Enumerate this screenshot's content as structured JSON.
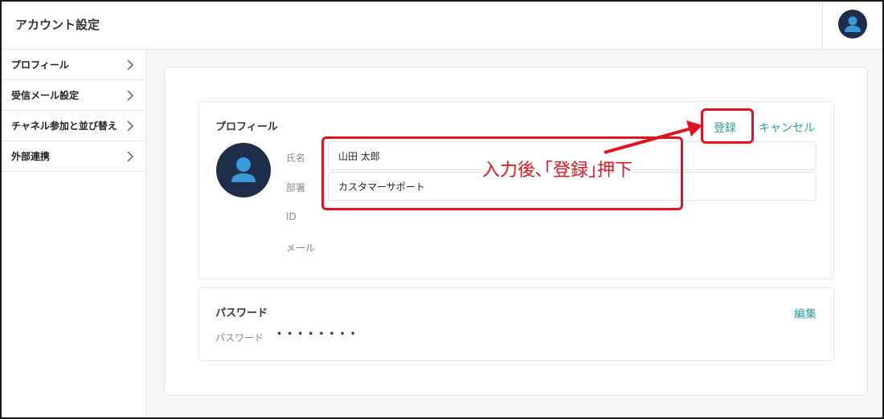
{
  "header": {
    "title": "アカウント設定"
  },
  "sidebar": {
    "items": [
      {
        "label": "プロフィール"
      },
      {
        "label": "受信メール設定"
      },
      {
        "label": "チャネル参加と並び替え"
      },
      {
        "label": "外部連携"
      }
    ]
  },
  "profile": {
    "title": "プロフィール",
    "save_label": "登録",
    "cancel_label": "キャンセル",
    "fields": {
      "name_label": "氏名",
      "name_value": "山田 太郎",
      "dept_label": "部署",
      "dept_value": "カスタマーサポート",
      "id_label": "ID",
      "mail_label": "メール"
    }
  },
  "password": {
    "title": "パスワード",
    "edit_label": "編集",
    "field_label": "パスワード",
    "masked_value": "••••••••"
  },
  "annotation": {
    "text": "入力後､｢登録｣押下"
  },
  "colors": {
    "accent": "#2a9d9d",
    "annotation": "#e0141e",
    "avatar_bg": "#1e2d4a",
    "avatar_fg": "#3a9ad9"
  }
}
